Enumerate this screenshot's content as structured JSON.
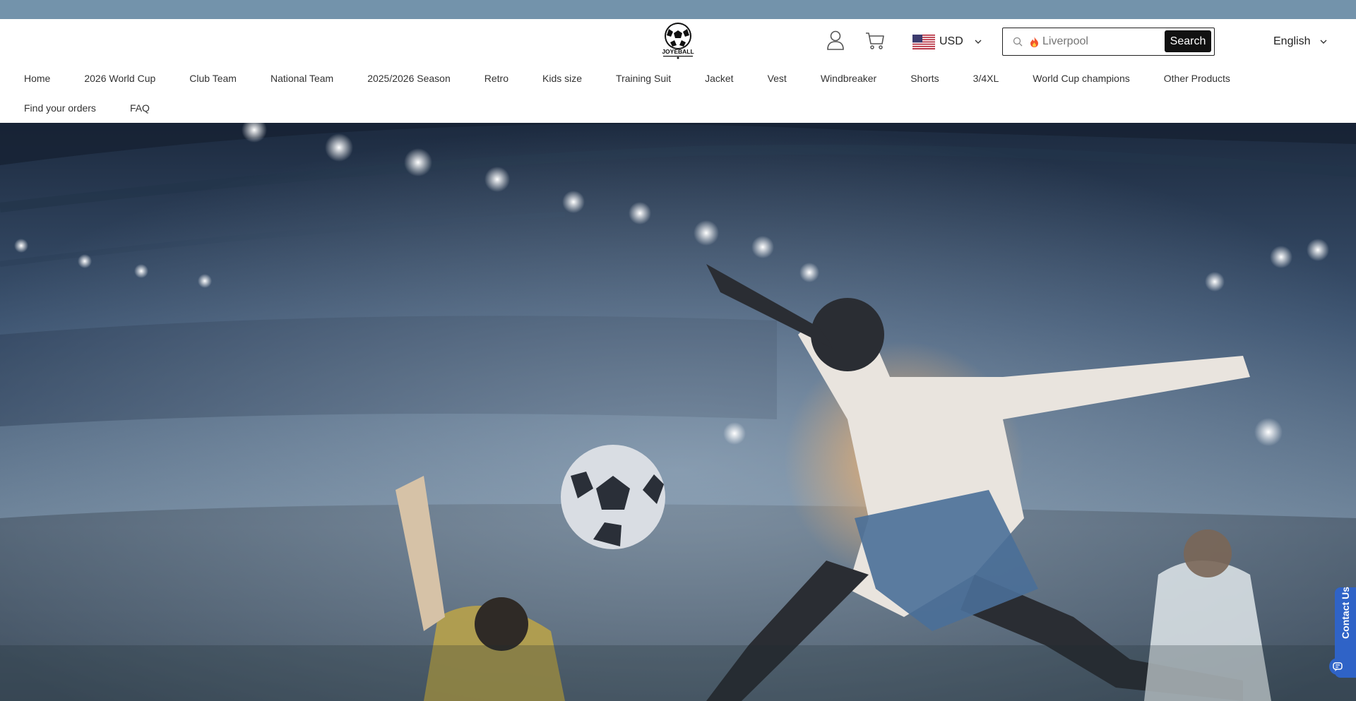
{
  "brand": {
    "logo_text": "JOYEBALL"
  },
  "header": {
    "account_icon": "user-icon",
    "cart_icon": "cart-icon",
    "currency": {
      "flag_icon": "us-flag-icon",
      "label": "USD"
    },
    "search": {
      "placeholder": "Liverpool",
      "button_label": "Search"
    },
    "language": {
      "label": "English"
    }
  },
  "nav": {
    "row1": [
      {
        "label": "Home"
      },
      {
        "label": "2026 World Cup"
      },
      {
        "label": "Club Team"
      },
      {
        "label": "National Team"
      },
      {
        "label": "2025/2026 Season"
      },
      {
        "label": "Retro"
      },
      {
        "label": "Kids size"
      },
      {
        "label": "Training Suit"
      },
      {
        "label": "Jacket"
      },
      {
        "label": "Vest"
      },
      {
        "label": "Windbreaker"
      },
      {
        "label": "Shorts"
      },
      {
        "label": "3/4XL"
      },
      {
        "label": "World Cup champions"
      },
      {
        "label": "Other Products"
      }
    ],
    "row2": [
      {
        "label": "Find your orders"
      },
      {
        "label": "FAQ"
      }
    ]
  },
  "contact": {
    "label": "Contact Us"
  },
  "colors": {
    "topbar": "#7393ab",
    "contact_tab": "#2f63c7"
  }
}
